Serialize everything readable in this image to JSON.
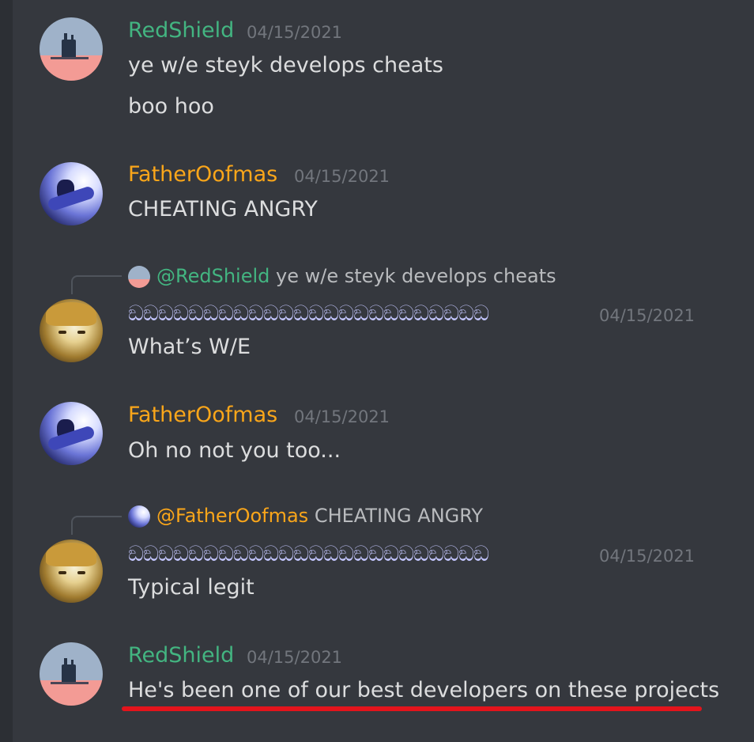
{
  "messages": [
    {
      "author": "RedShield",
      "timestamp": "04/15/2021",
      "lines": [
        "ye w/e steyk develops cheats",
        "boo hoo"
      ]
    },
    {
      "author": "FatherOofmas",
      "timestamp": "04/15/2021",
      "lines": [
        "CHEATING ANGRY"
      ]
    },
    {
      "reply": {
        "mention": "@RedShield",
        "text": "ye w/e steyk develops cheats"
      },
      "author": "ඞඞඞඞඞඞඞඞඞඞඞඞඞඞඞඞඞඞඞඞඞඞඞඞ",
      "timestamp": "04/15/2021",
      "lines": [
        "What’s W/E"
      ]
    },
    {
      "author": "FatherOofmas",
      "timestamp": "04/15/2021",
      "lines": [
        "Oh no not you too..."
      ]
    },
    {
      "reply": {
        "mention": "@FatherOofmas",
        "text": "CHEATING ANGRY"
      },
      "author": "ඞඞඞඞඞඞඞඞඞඞඞඞඞඞඞඞඞඞඞඞඞඞඞඞ",
      "timestamp": "04/15/2021",
      "lines": [
        "Typical legit"
      ]
    },
    {
      "author": "RedShield",
      "timestamp": "04/15/2021",
      "lines": [
        "He's been one of our best developers on these projects"
      ]
    }
  ],
  "colors": {
    "background": "#35383e",
    "redshield_name": "#43b581",
    "father_name": "#faa61a",
    "highlight_underline": "#e3141c",
    "message_text": "#dcddde",
    "timestamp": "#72767d"
  },
  "icons": [
    "redshield-avatar",
    "fatheroofmas-avatar",
    "anime-avatar"
  ]
}
